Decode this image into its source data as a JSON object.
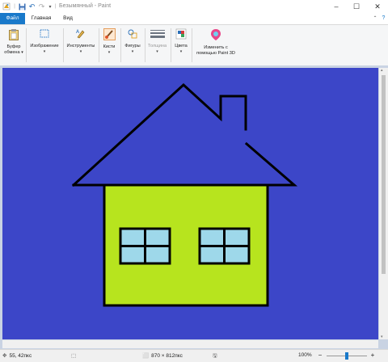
{
  "window": {
    "title": "Безымянный - Paint",
    "qa_customize": "▾",
    "controls": {
      "minimize": "–",
      "maximize": "☐",
      "close": "✕"
    }
  },
  "tabs": [
    {
      "label": "Файл",
      "active": true
    },
    {
      "label": "Главная"
    },
    {
      "label": "Вид"
    }
  ],
  "ribbon": {
    "clipboard": {
      "line1": "Буфер",
      "line2": "обмена",
      "arrow": "▾"
    },
    "image": {
      "label": "Изображение",
      "arrow": "▾"
    },
    "tools": {
      "label": "Инструменты",
      "arrow": "▾"
    },
    "brushes": {
      "label": "Кисти",
      "arrow": "▾"
    },
    "shapes": {
      "label": "Фигуры",
      "arrow": "▾"
    },
    "size": {
      "label": "Толщина",
      "arrow": "▾"
    },
    "colors": {
      "label": "Цвета",
      "arrow": "▾"
    },
    "paint3d": {
      "line1": "Изменить с",
      "line2": "помощью Paint 3D"
    }
  },
  "canvas": {
    "background": "#3c46c8",
    "house": {
      "wall_color": "#b7e41e",
      "window_color": "#9ed8ea",
      "line_color": "#000000"
    }
  },
  "status": {
    "cursor_pos": "55, 42пкс",
    "canvas_size": "870 × 812пкс",
    "zoom": "100%",
    "zoom_out": "−",
    "zoom_in": "+",
    "zoom_level": 0.5
  },
  "colors": {
    "accent": "#1979ca",
    "workspace": "#c9d3e3"
  }
}
